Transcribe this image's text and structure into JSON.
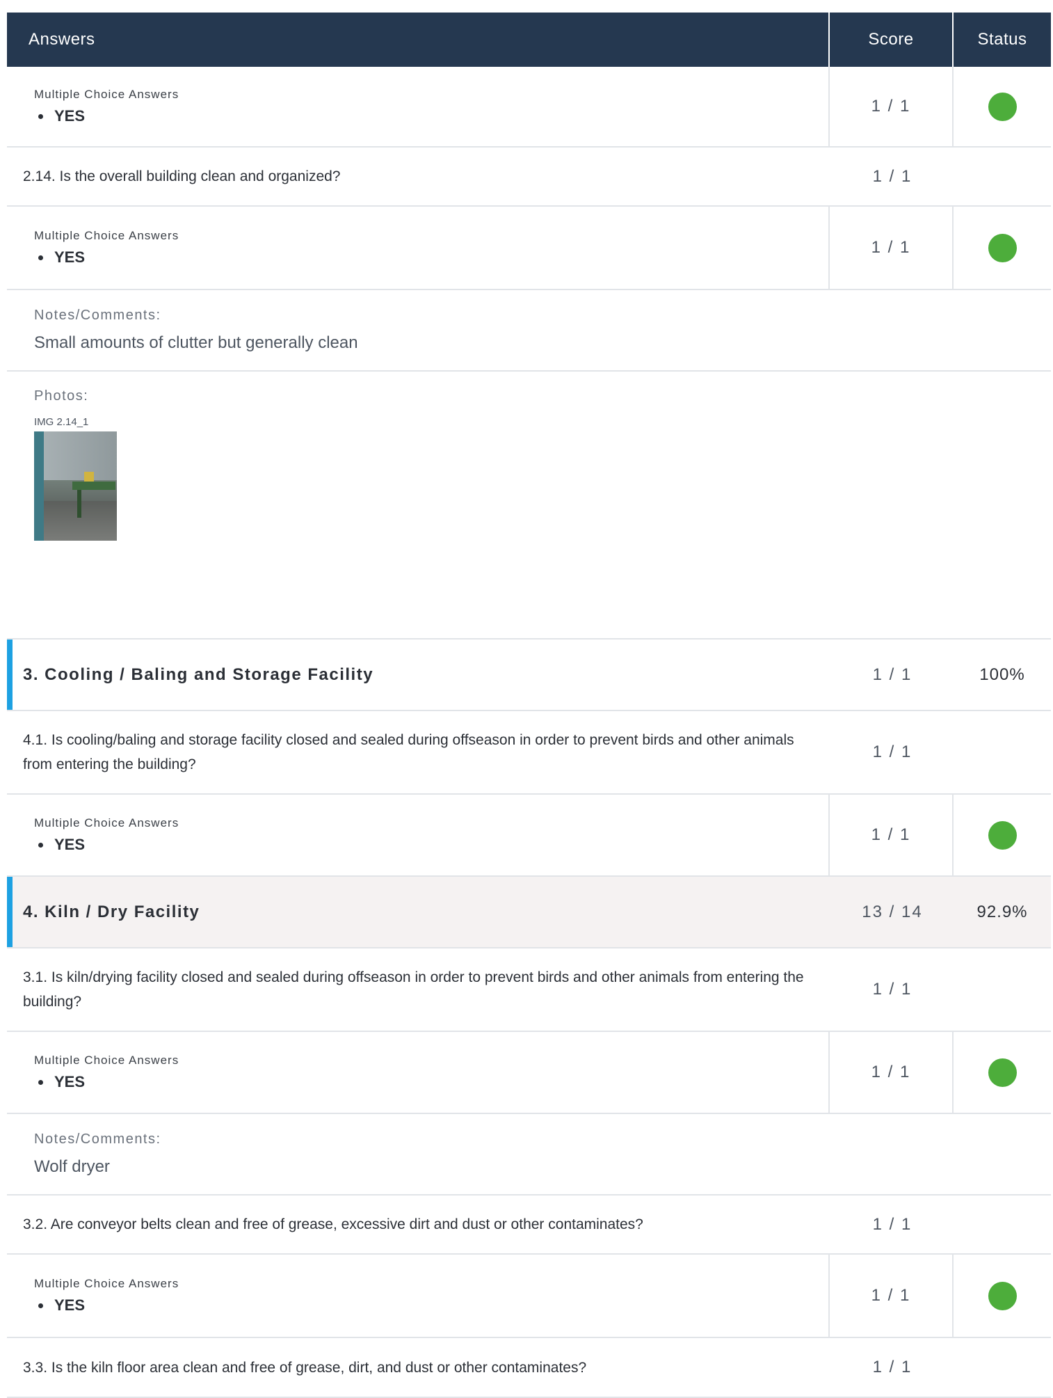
{
  "header": {
    "answers": "Answers",
    "score": "Score",
    "status": "Status"
  },
  "rows": [
    {
      "type": "mc",
      "label": "Multiple Choice Answers",
      "answer": "YES",
      "score": "1 / 1",
      "status_color": "#4dad3b"
    },
    {
      "type": "question",
      "text": "2.14. Is the overall building clean and organized?",
      "score": "1 / 1"
    },
    {
      "type": "mc",
      "label": "Multiple Choice Answers",
      "answer": "YES",
      "score": "1 / 1",
      "status_color": "#4dad3b"
    },
    {
      "type": "note",
      "label": "Notes/Comments:",
      "text": "Small amounts of clutter but generally clean"
    },
    {
      "type": "photos",
      "label": "Photos:",
      "caption": "IMG 2.14_1"
    },
    {
      "type": "section",
      "title": "3. Cooling / Baling and Storage Facility",
      "score": "1 / 1",
      "percent": "100%"
    },
    {
      "type": "question",
      "text": "4.1. Is cooling/baling and storage facility closed and sealed during offseason in order to prevent birds and other animals from entering the building?",
      "score": "1 / 1"
    },
    {
      "type": "mc",
      "label": "Multiple Choice Answers",
      "answer": "YES",
      "score": "1 / 1",
      "status_color": "#4dad3b"
    },
    {
      "type": "section",
      "title": "4. Kiln / Dry Facility",
      "score": "13 / 14",
      "percent": "92.9%"
    },
    {
      "type": "question",
      "text": "3.1. Is kiln/drying facility closed and sealed during offseason in order to prevent birds and other animals from entering the building?",
      "score": "1 / 1"
    },
    {
      "type": "mc",
      "label": "Multiple Choice Answers",
      "answer": "YES",
      "score": "1 / 1",
      "status_color": "#4dad3b"
    },
    {
      "type": "note",
      "label": "Notes/Comments:",
      "text": "Wolf dryer"
    },
    {
      "type": "question",
      "text": "3.2. Are conveyor belts clean and free of grease, excessive dirt and dust or other contaminates?",
      "score": "1 / 1"
    },
    {
      "type": "mc",
      "label": "Multiple Choice Answers",
      "answer": "YES",
      "score": "1 / 1",
      "status_color": "#4dad3b"
    },
    {
      "type": "question",
      "text": "3.3. Is the kiln floor area clean and free of grease, dirt, and dust or other contaminates?",
      "score": "1 / 1"
    }
  ]
}
